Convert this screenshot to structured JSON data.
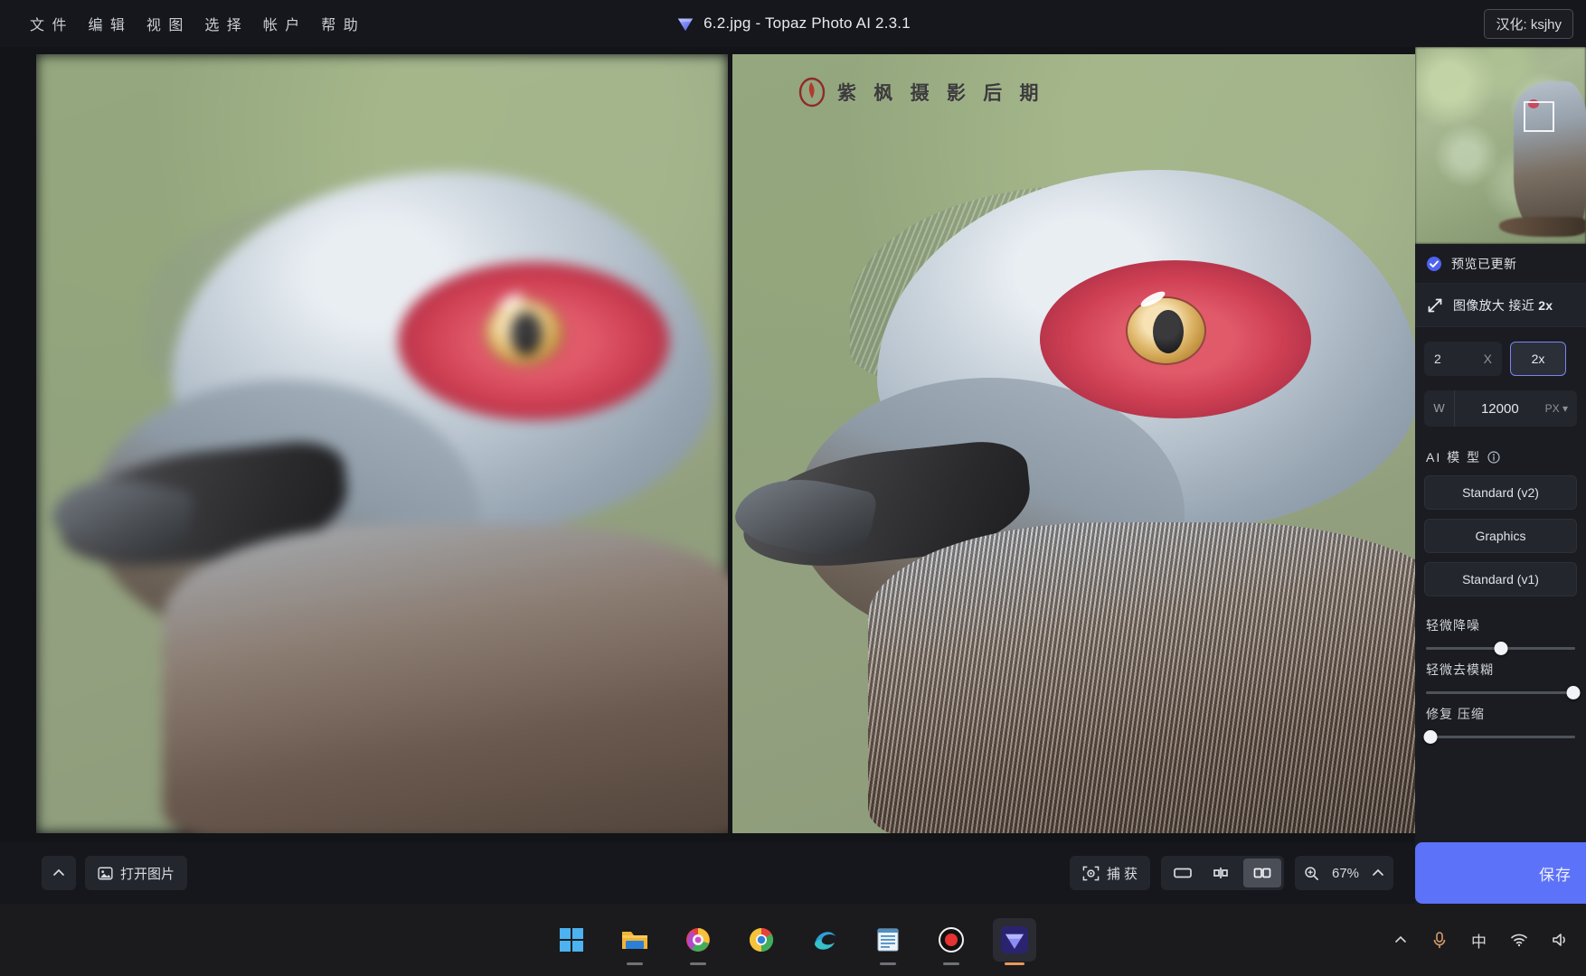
{
  "titlebar": {
    "menu": [
      {
        "label": "文 件",
        "name": "menu-file"
      },
      {
        "label": "编 辑",
        "name": "menu-edit"
      },
      {
        "label": "视 图",
        "name": "menu-view"
      },
      {
        "label": "选 择",
        "name": "menu-select"
      },
      {
        "label": "帐 户",
        "name": "menu-account"
      },
      {
        "label": "帮 助",
        "name": "menu-help"
      }
    ],
    "title": "6.2.jpg - Topaz Photo AI 2.3.1",
    "lang_badge": "汉化: ksjhy"
  },
  "watermark": {
    "text": "紫 枫 摄 影 后 期"
  },
  "bottombar": {
    "collapse_icon": "chevron-up-icon",
    "open_image_label": "打开图片",
    "capture_label": "捕 获",
    "view_modes": [
      {
        "name": "view-single",
        "icon": "rectangle-icon",
        "active": false
      },
      {
        "name": "view-split",
        "icon": "split-compare-icon",
        "active": false
      },
      {
        "name": "view-side-by-side",
        "icon": "side-by-side-icon",
        "active": true
      }
    ],
    "zoom_value": "67%",
    "zoom_icon": "magnifier-plus-icon",
    "zoom_expand_icon": "chevron-up-icon"
  },
  "rightpanel": {
    "navigator": {
      "name": "navigator-thumbnail",
      "selection_rect": "viewport-rect"
    },
    "status": {
      "icon": "check-circle-icon",
      "label": "预览已更新"
    },
    "upscale": {
      "icon": "upscale-arrow-icon",
      "label": "图像放大 接近 ",
      "value": "2x"
    },
    "scale": {
      "factor": "2",
      "x_label": "X",
      "chip_label": "2x"
    },
    "width": {
      "label": "W",
      "value": "12000",
      "unit": "PX ▾"
    },
    "ai_model": {
      "heading": "AI 模 型",
      "info_icon": "info-icon",
      "options": [
        {
          "label": "Standard (v2)",
          "name": "model-standard-v2"
        },
        {
          "label": "Graphics",
          "name": "model-graphics"
        },
        {
          "label": "Standard (v1)",
          "name": "model-standard-v1"
        }
      ]
    },
    "sliders": [
      {
        "label": "轻微降噪",
        "name": "slider-denoise",
        "percent": 50
      },
      {
        "label": "轻微去模糊",
        "name": "slider-deblur",
        "percent": 99
      },
      {
        "label": "修复 压缩",
        "name": "slider-recover-compression",
        "percent": 3
      }
    ],
    "save_label": "保存"
  },
  "taskbar": {
    "items": [
      {
        "name": "taskbar-start",
        "icon": "windows-start-icon",
        "active": false,
        "running": false
      },
      {
        "name": "taskbar-file-explorer",
        "icon": "folder-icon",
        "active": false,
        "running": true
      },
      {
        "name": "taskbar-chrome-beta",
        "icon": "chrome-colorful-icon",
        "active": false,
        "running": true
      },
      {
        "name": "taskbar-chrome",
        "icon": "chrome-icon",
        "active": false,
        "running": false
      },
      {
        "name": "taskbar-edge",
        "icon": "edge-icon",
        "active": false,
        "running": false
      },
      {
        "name": "taskbar-notepad",
        "icon": "notepad-icon",
        "active": false,
        "running": true
      },
      {
        "name": "taskbar-recorder",
        "icon": "record-circle-icon",
        "active": false,
        "running": true
      },
      {
        "name": "taskbar-topaz",
        "icon": "gem-icon",
        "active": true,
        "running": true
      }
    ],
    "tray": [
      {
        "name": "tray-overflow",
        "icon": "chevron-up-icon",
        "glyph": "⌃"
      },
      {
        "name": "tray-microphone",
        "icon": "microphone-icon",
        "glyph": "🎤"
      },
      {
        "name": "tray-ime",
        "icon": "ime-chinese-icon",
        "glyph": "中"
      },
      {
        "name": "tray-wifi",
        "icon": "wifi-icon",
        "glyph": "📶"
      },
      {
        "name": "tray-volume",
        "icon": "speaker-icon",
        "glyph": "🔊"
      }
    ]
  },
  "colors": {
    "accent": "#5c72f8",
    "panel_bg": "#1a1c21",
    "chrome_bg": "#15171c",
    "chip_border": "#7b84f5"
  }
}
